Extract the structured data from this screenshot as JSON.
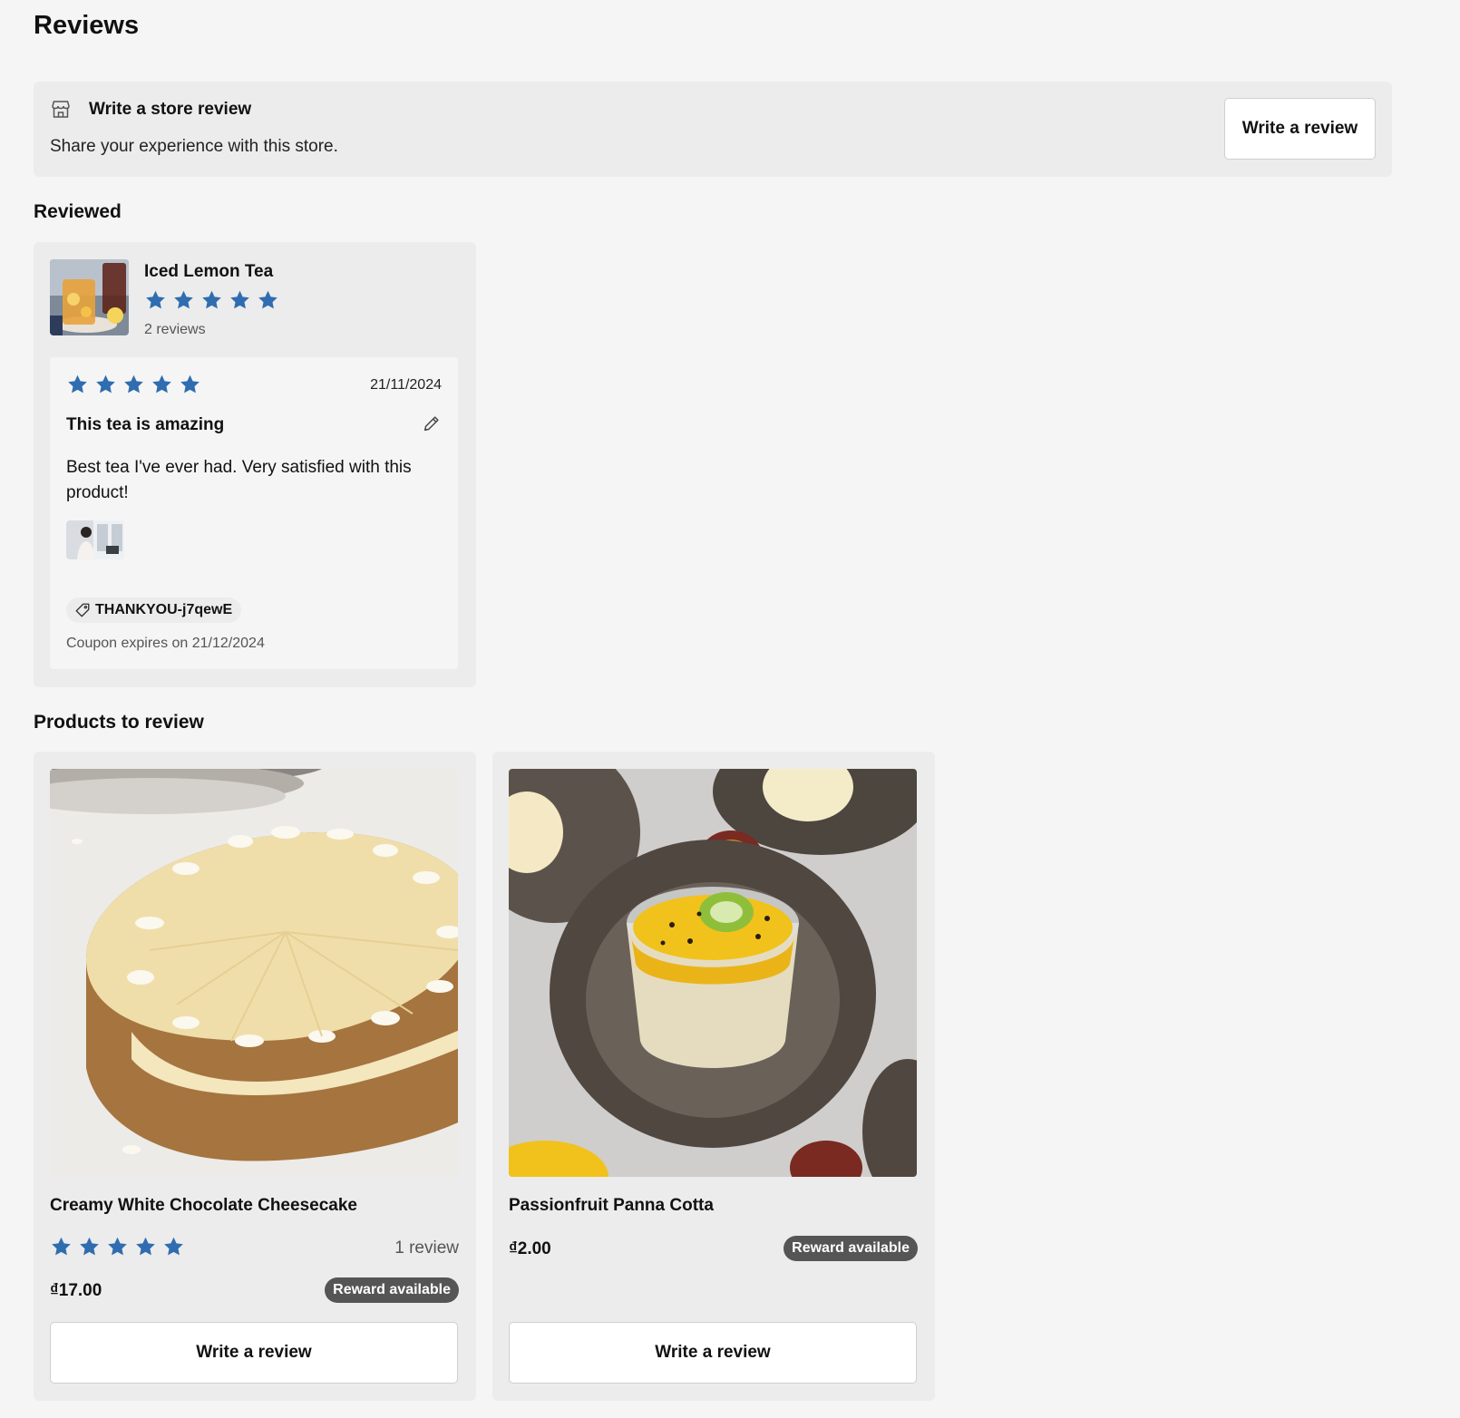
{
  "page": {
    "title": "Reviews"
  },
  "store_review": {
    "title": "Write a store review",
    "subtitle": "Share your experience with this store.",
    "button_label": "Write a review",
    "icon": "store-icon"
  },
  "reviewed": {
    "section_title": "Reviewed",
    "product": {
      "name": "Iced Lemon Tea",
      "rating": 5,
      "review_count": "2 reviews"
    },
    "review": {
      "rating": 5,
      "date": "21/11/2024",
      "title": "This tea is amazing",
      "body": "Best tea I've ever had. Very satisfied with this product!",
      "coupon_code": "THANKYOU-j7qewE",
      "coupon_expiry": "Coupon expires on 21/12/2024"
    }
  },
  "products_to_review": {
    "section_title": "Products to review",
    "items": [
      {
        "name": "Creamy White Chocolate Cheesecake",
        "rating": 5,
        "review_count": "1 review",
        "price": "₫17.00",
        "badge": "Reward available",
        "button_label": "Write a review"
      },
      {
        "name": "Passionfruit Panna Cotta",
        "price": "₫2.00",
        "badge": "Reward available",
        "button_label": "Write a review"
      }
    ]
  },
  "colors": {
    "star": "#2f6db0",
    "badge": "#555555",
    "card": "#ececec",
    "page": "#f5f5f5"
  }
}
